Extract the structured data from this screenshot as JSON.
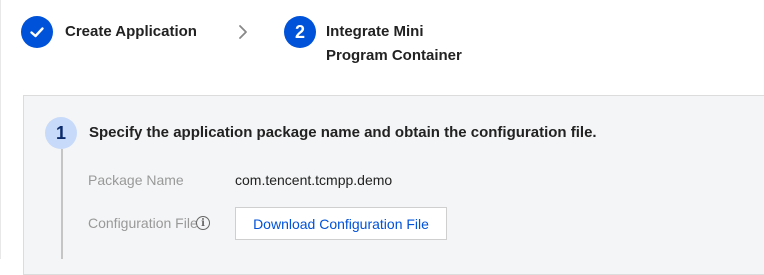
{
  "stepper": {
    "step1": {
      "label": "Create Application",
      "icon": "check-icon"
    },
    "separator_icon": "chevron-right-icon",
    "step2": {
      "number": "2",
      "label": "Integrate Mini\nProgram Container"
    }
  },
  "section": {
    "number": "1",
    "title": "Specify the application package name and obtain the configuration file."
  },
  "fields": {
    "package_name_label": "Package Name",
    "package_name_value": "com.tencent.tcmpp.demo",
    "config_file_label": "Configuration File",
    "info_icon": "i",
    "download_button": "Download Configuration File"
  },
  "colors": {
    "primary": "#0052d9",
    "panel_bg": "#f4f5f6",
    "sub_step_circle": "#c7daf9"
  }
}
